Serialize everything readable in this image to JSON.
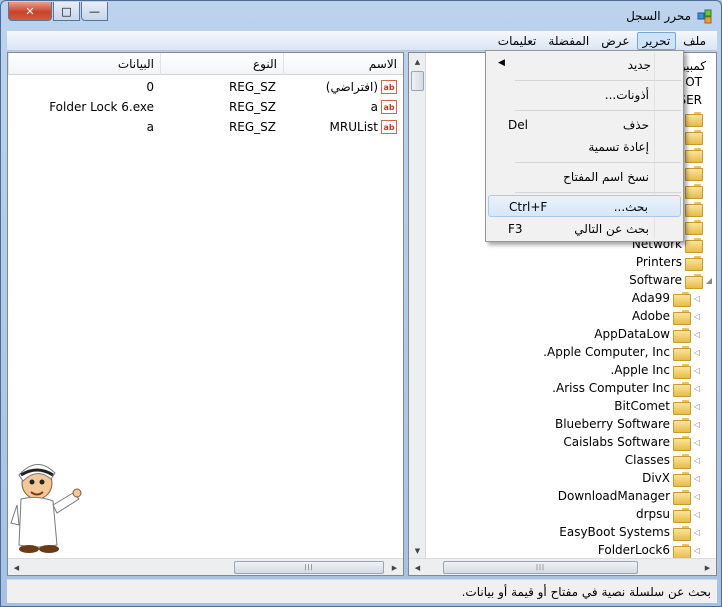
{
  "window": {
    "title": "محرر السجل",
    "close_glyph": "✕",
    "max_glyph": "□",
    "min_glyph": "—"
  },
  "menubar": {
    "items": [
      "ملف",
      "تحرير",
      "عرض",
      "المفضلة",
      "تعليمات"
    ],
    "active": "تحرير"
  },
  "edit_menu": {
    "new": "جديد",
    "permissions": "أذونات...",
    "delete": "حذف",
    "delete_shortcut": "Del",
    "rename": "إعادة تسمية",
    "copy_key_name": "نسخ اسم المفتاح",
    "find": "بحث...",
    "find_shortcut": "Ctrl+F",
    "find_next": "بحث عن التالي",
    "find_next_shortcut": "F3"
  },
  "tree": {
    "partial": [
      "كمبيوت",
      "OT",
      "SER"
    ],
    "items": [
      "Network",
      "Printers",
      "Software",
      "Ada99",
      "Adobe",
      "AppDataLow",
      "Apple Computer, Inc.",
      "Apple Inc.",
      "Ariss Computer Inc.",
      "BitComet",
      "Blueberry Software",
      "Caislabs Software",
      "Classes",
      "DivX",
      "DownloadManager",
      "drpsu",
      "EasyBoot Systems",
      "FolderLock6"
    ]
  },
  "list": {
    "headers": {
      "name": "الاسم",
      "type": "النوع",
      "data": "البيانات"
    },
    "rows": [
      {
        "name": "(افتراضي)",
        "type": "REG_SZ",
        "data": "0"
      },
      {
        "name": "a",
        "type": "REG_SZ",
        "data": "Folder Lock 6.exe"
      },
      {
        "name": "MRUList",
        "type": "REG_SZ",
        "data": "a"
      }
    ],
    "value_icon": "ab"
  },
  "statusbar": {
    "text": "بحث عن سلسلة نصية في مفتاح أو قيمة أو بيانات."
  },
  "icons": {
    "app": "registry-editor-icon",
    "folder": "folder-icon",
    "value": "string-value-icon"
  }
}
